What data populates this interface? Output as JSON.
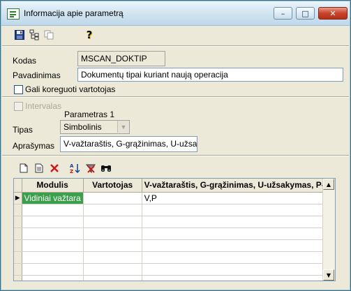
{
  "window": {
    "title": "Informacija apie parametrą",
    "minimize_glyph": "–",
    "maximize_glyph": "□",
    "close_glyph": "✕"
  },
  "toolbar": {
    "icons": [
      "save-icon",
      "tree-icon",
      "copy-icon",
      "help-icon"
    ],
    "help_glyph": "?"
  },
  "form": {
    "kodas_label": "Kodas",
    "kodas_value": "MSCAN_DOKTIP",
    "pavadinimas_label": "Pavadinimas",
    "pavadinimas_value": "Dokumentų tipai kuriant naują operacija",
    "editable_label": "Gali koreguoti vartotojas",
    "intervalas_label": "Intervalas",
    "parametras_label": "Parametras 1",
    "tipas_label": "Tipas",
    "tipas_value": "Simbolinis",
    "aprasymas_label": "Aprašymas",
    "aprasymas_value": "V-važtaraštis, G-grąžinimas, U-užsa"
  },
  "grid_toolbar": {
    "icons": [
      "new-icon",
      "edit-icon",
      "delete-icon",
      "sort-az-icon",
      "clear-filter-icon",
      "find-icon"
    ]
  },
  "grid": {
    "columns": [
      "Modulis",
      "Vartotojas",
      "V-važtaraštis, G-grąžinimas, U-užsakymas, P-p"
    ],
    "rows": [
      {
        "modulis": "Vidiniai važtara",
        "vartotojas": "",
        "value": "V,P"
      }
    ],
    "empty_rows": 7
  },
  "colors": {
    "selection": "#3aa04c",
    "close_button": "#c8432b",
    "window_background": "#ece9d8"
  }
}
